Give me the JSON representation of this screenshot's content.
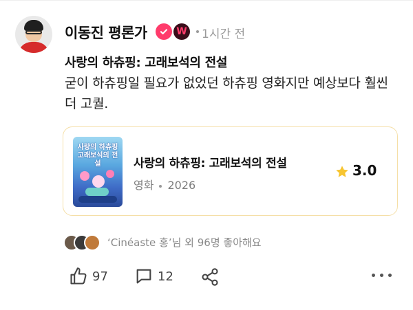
{
  "author": {
    "name": "이동진 평론가",
    "badge_letter": "W",
    "time": "1시간 전"
  },
  "post": {
    "title": "사랑의 하츄핑: 고래보석의 전설",
    "body": "굳이 하츄핑일 필요가 없었던 하츄핑 영화지만 예상보다 훨씬 더 고퀄."
  },
  "card": {
    "poster_title": "사랑의 하츄핑 고래보석의 전설",
    "title": "사랑의 하츄핑: 고래보석의 전설",
    "category": "영화",
    "year": "2026",
    "rating": "3.0"
  },
  "likes_summary": "‘Cinéaste 홍’님 외 96명 좋아해요",
  "actions": {
    "like_count": "97",
    "comment_count": "12"
  },
  "colors": {
    "verified": "#ff3b6b",
    "card_border": "#f5dfa7",
    "star": "#f7c531"
  },
  "icons": [
    "verified-check-icon",
    "w-badge-icon",
    "star-icon",
    "thumbs-up-icon",
    "comment-icon",
    "share-icon",
    "more-icon"
  ]
}
